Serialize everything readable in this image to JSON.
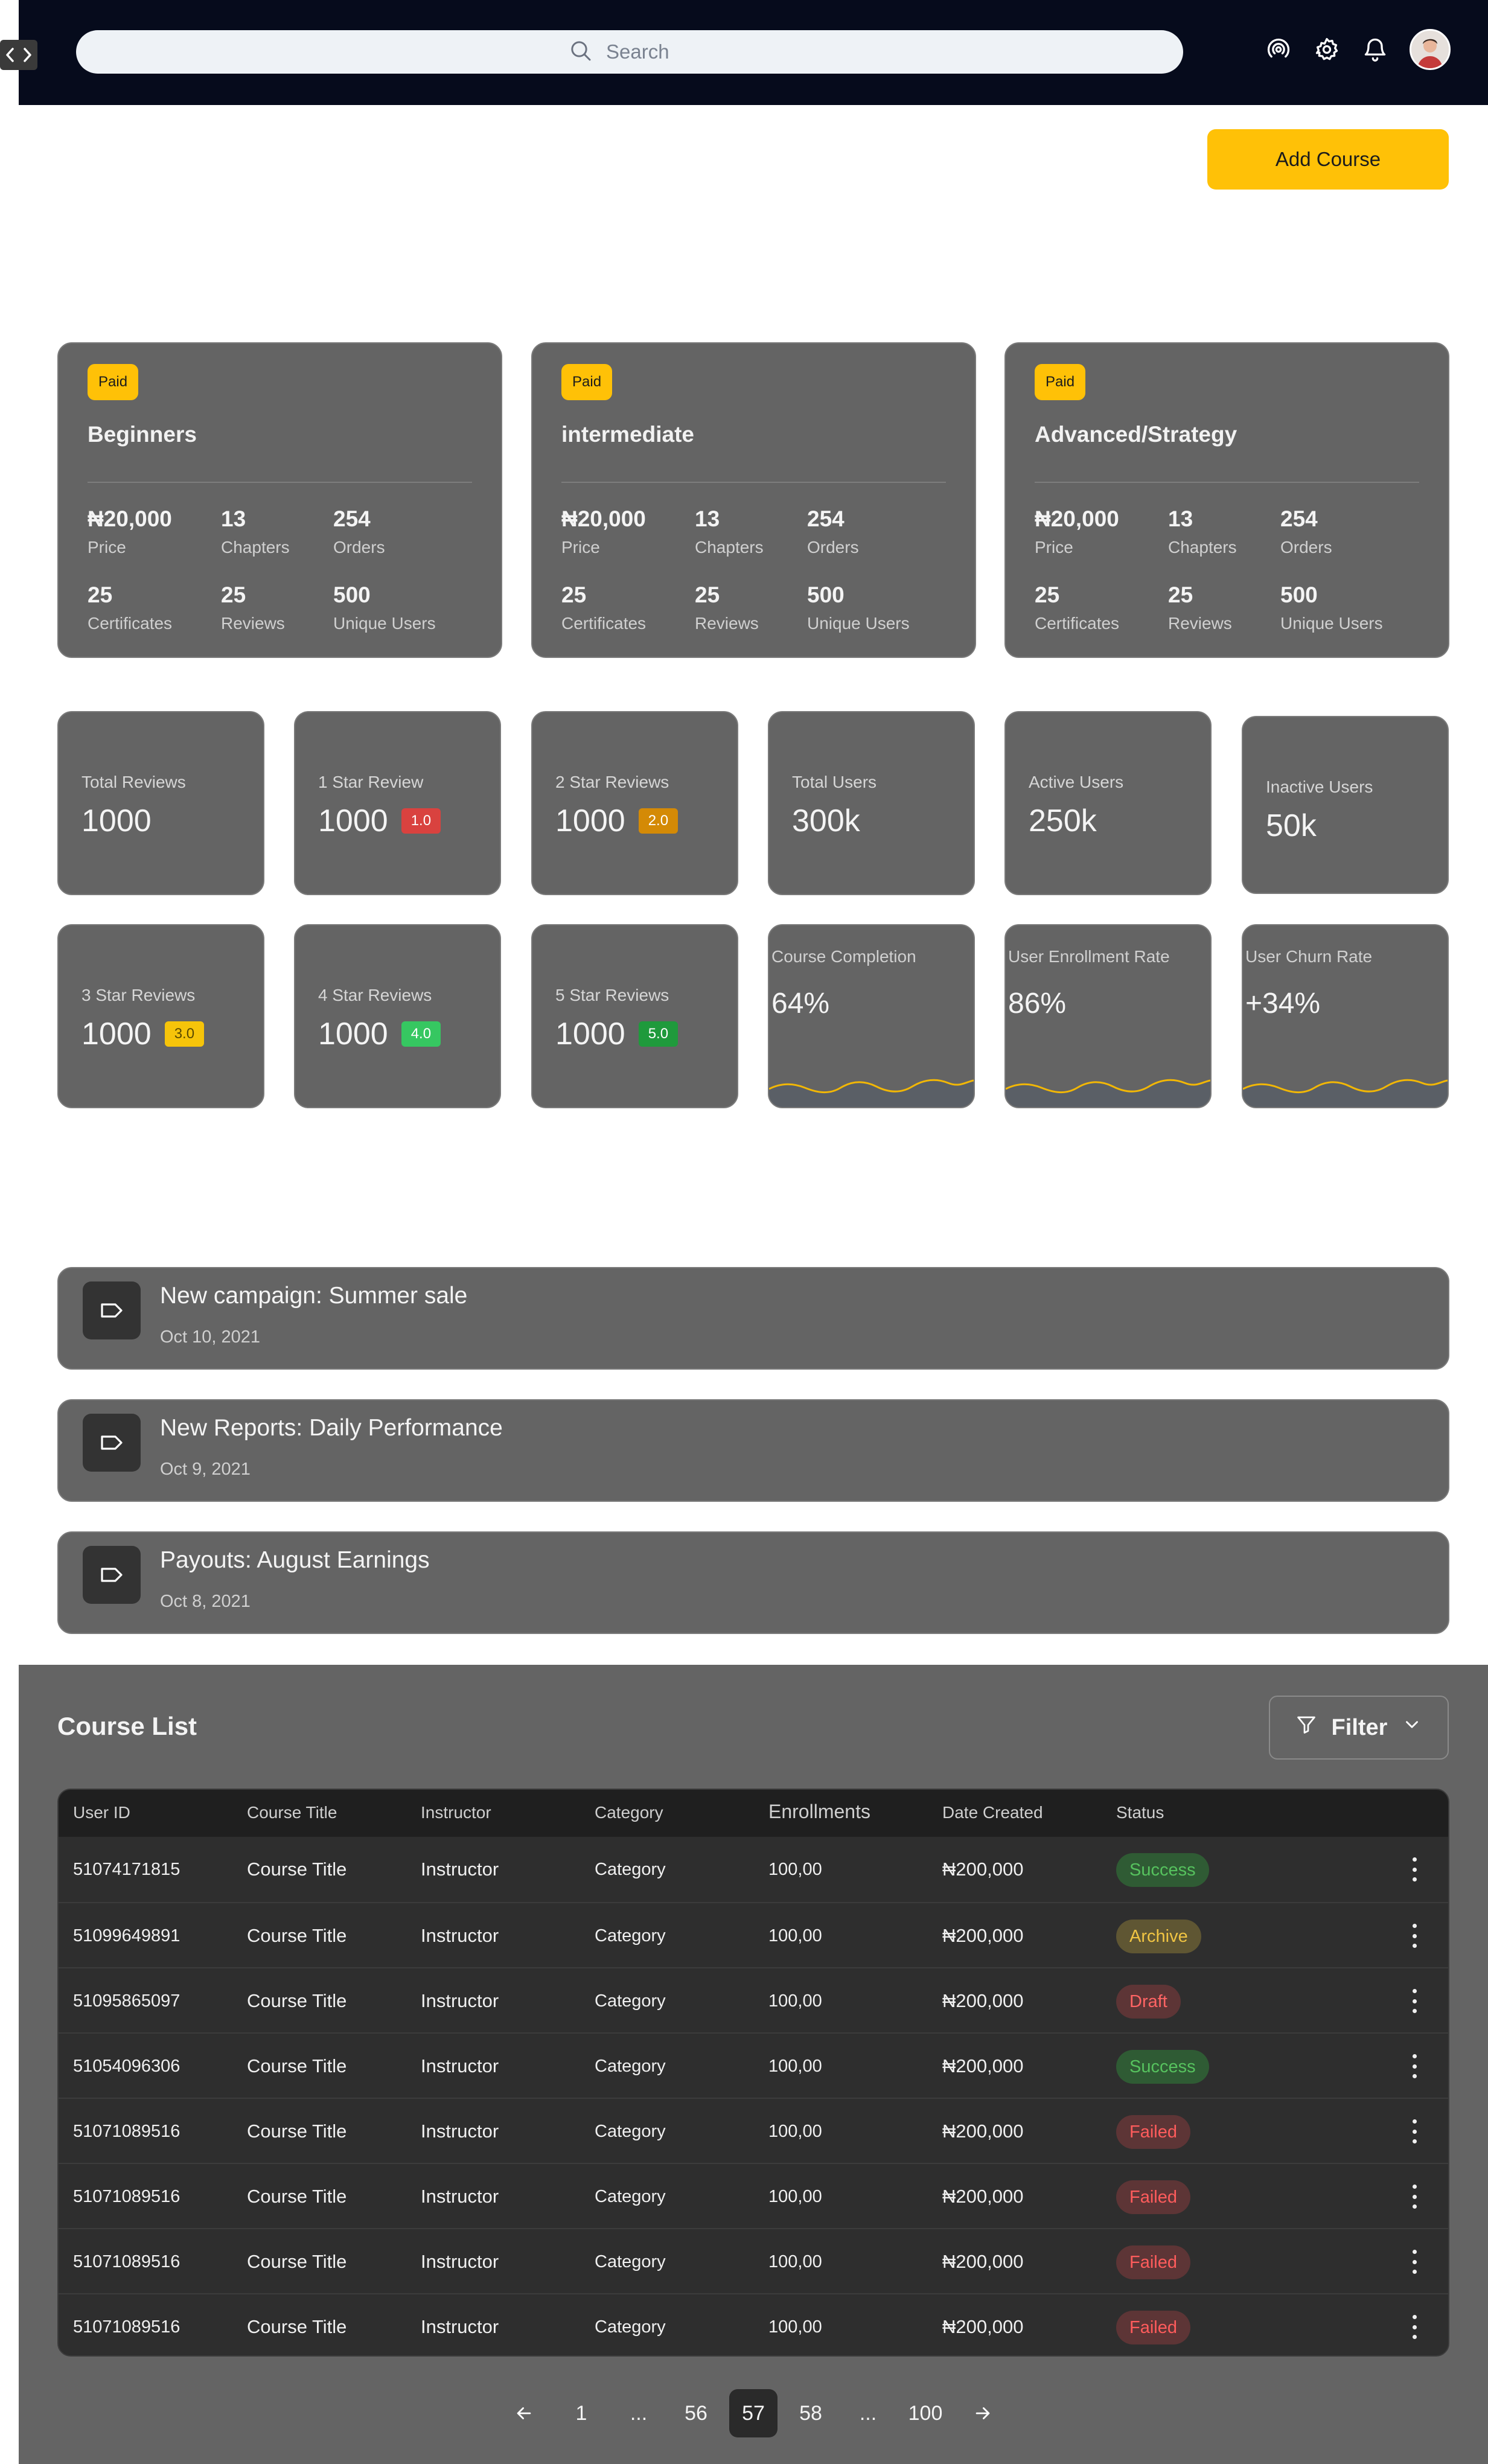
{
  "search": {
    "placeholder": "Search"
  },
  "header": {
    "add_course_label": "Add Course"
  },
  "courses": [
    {
      "badge": "Paid",
      "title": "Beginners",
      "stats": [
        {
          "value": "₦20,000",
          "label": "Price"
        },
        {
          "value": "13",
          "label": "Chapters"
        },
        {
          "value": "254",
          "label": "Orders"
        },
        {
          "value": "25",
          "label": "Certificates"
        },
        {
          "value": "25",
          "label": "Reviews"
        },
        {
          "value": "500",
          "label": "Unique Users"
        }
      ]
    },
    {
      "badge": "Paid",
      "title": "intermediate",
      "stats": [
        {
          "value": "₦20,000",
          "label": "Price"
        },
        {
          "value": "13",
          "label": "Chapters"
        },
        {
          "value": "254",
          "label": "Orders"
        },
        {
          "value": "25",
          "label": "Certificates"
        },
        {
          "value": "25",
          "label": "Reviews"
        },
        {
          "value": "500",
          "label": "Unique Users"
        }
      ]
    },
    {
      "badge": "Paid",
      "title": "Advanced/Strategy",
      "stats": [
        {
          "value": "₦20,000",
          "label": "Price"
        },
        {
          "value": "13",
          "label": "Chapters"
        },
        {
          "value": "254",
          "label": "Orders"
        },
        {
          "value": "25",
          "label": "Certificates"
        },
        {
          "value": "25",
          "label": "Reviews"
        },
        {
          "value": "500",
          "label": "Unique Users"
        }
      ]
    }
  ],
  "metrics": [
    {
      "label": "Total Reviews",
      "value": "1000"
    },
    {
      "label": "1 Star Review",
      "value": "1000",
      "badge": "1.0",
      "badge_color": "#d9423f"
    },
    {
      "label": "2 Star Reviews",
      "value": "1000",
      "badge": "2.0",
      "badge_color": "#d48a06"
    },
    {
      "label": "Total Users",
      "value": "300k"
    },
    {
      "label": "Active Users",
      "value": "250k"
    },
    {
      "label": "Inactive Users",
      "value": "50k"
    },
    {
      "label": "3 Star Reviews",
      "value": "1000",
      "badge": "3.0",
      "badge_color": "#f6c40a"
    },
    {
      "label": "4 Star Reviews",
      "value": "1000",
      "badge": "4.0",
      "badge_color": "#36c761"
    },
    {
      "label": "5 Star Reviews",
      "value": "1000",
      "badge": "5.0",
      "badge_color": "#1f9a3c"
    },
    {
      "label": "Course Completion",
      "value": "64%"
    },
    {
      "label": "User Enrollment Rate",
      "value": "86%"
    },
    {
      "label": "User Churn Rate",
      "value": "+34%"
    }
  ],
  "notifications": [
    {
      "title": "New campaign: Summer sale",
      "date": "Oct 10, 2021"
    },
    {
      "title": "New Reports: Daily Performance",
      "date": "Oct 9, 2021"
    },
    {
      "title": "Payouts: August Earnings",
      "date": "Oct 8, 2021"
    }
  ],
  "course_list": {
    "title": "Course List",
    "filter_label": "Filter",
    "columns": [
      "User ID",
      "Course Title",
      "Instructor",
      "Category",
      "Enrollments",
      "Date Created",
      "Status"
    ],
    "rows": [
      {
        "id": "51074171815",
        "title": "Course Title",
        "instructor": "Instructor",
        "category": "Category",
        "enrollments": "100,00",
        "date": "₦200,000",
        "status": "Success"
      },
      {
        "id": "51099649891",
        "title": "Course Title",
        "instructor": "Instructor",
        "category": "Category",
        "enrollments": "100,00",
        "date": "₦200,000",
        "status": "Archive"
      },
      {
        "id": "51095865097",
        "title": "Course Title",
        "instructor": "Instructor",
        "category": "Category",
        "enrollments": "100,00",
        "date": "₦200,000",
        "status": "Draft"
      },
      {
        "id": "51054096306",
        "title": "Course Title",
        "instructor": "Instructor",
        "category": "Category",
        "enrollments": "100,00",
        "date": "₦200,000",
        "status": "Success"
      },
      {
        "id": "51071089516",
        "title": "Course Title",
        "instructor": "Instructor",
        "category": "Category",
        "enrollments": "100,00",
        "date": "₦200,000",
        "status": "Failed"
      },
      {
        "id": "51071089516",
        "title": "Course Title",
        "instructor": "Instructor",
        "category": "Category",
        "enrollments": "100,00",
        "date": "₦200,000",
        "status": "Failed"
      },
      {
        "id": "51071089516",
        "title": "Course Title",
        "instructor": "Instructor",
        "category": "Category",
        "enrollments": "100,00",
        "date": "₦200,000",
        "status": "Failed"
      },
      {
        "id": "51071089516",
        "title": "Course Title",
        "instructor": "Instructor",
        "category": "Category",
        "enrollments": "100,00",
        "date": "₦200,000",
        "status": "Failed"
      }
    ]
  },
  "pagination": {
    "pages": [
      "1",
      "...",
      "56",
      "57",
      "58",
      "...",
      "100"
    ],
    "current": "57"
  },
  "colors": {
    "accent": "#ffc107",
    "topbar": "#060b1c",
    "card": "#646464",
    "spark": "#f2b705"
  }
}
